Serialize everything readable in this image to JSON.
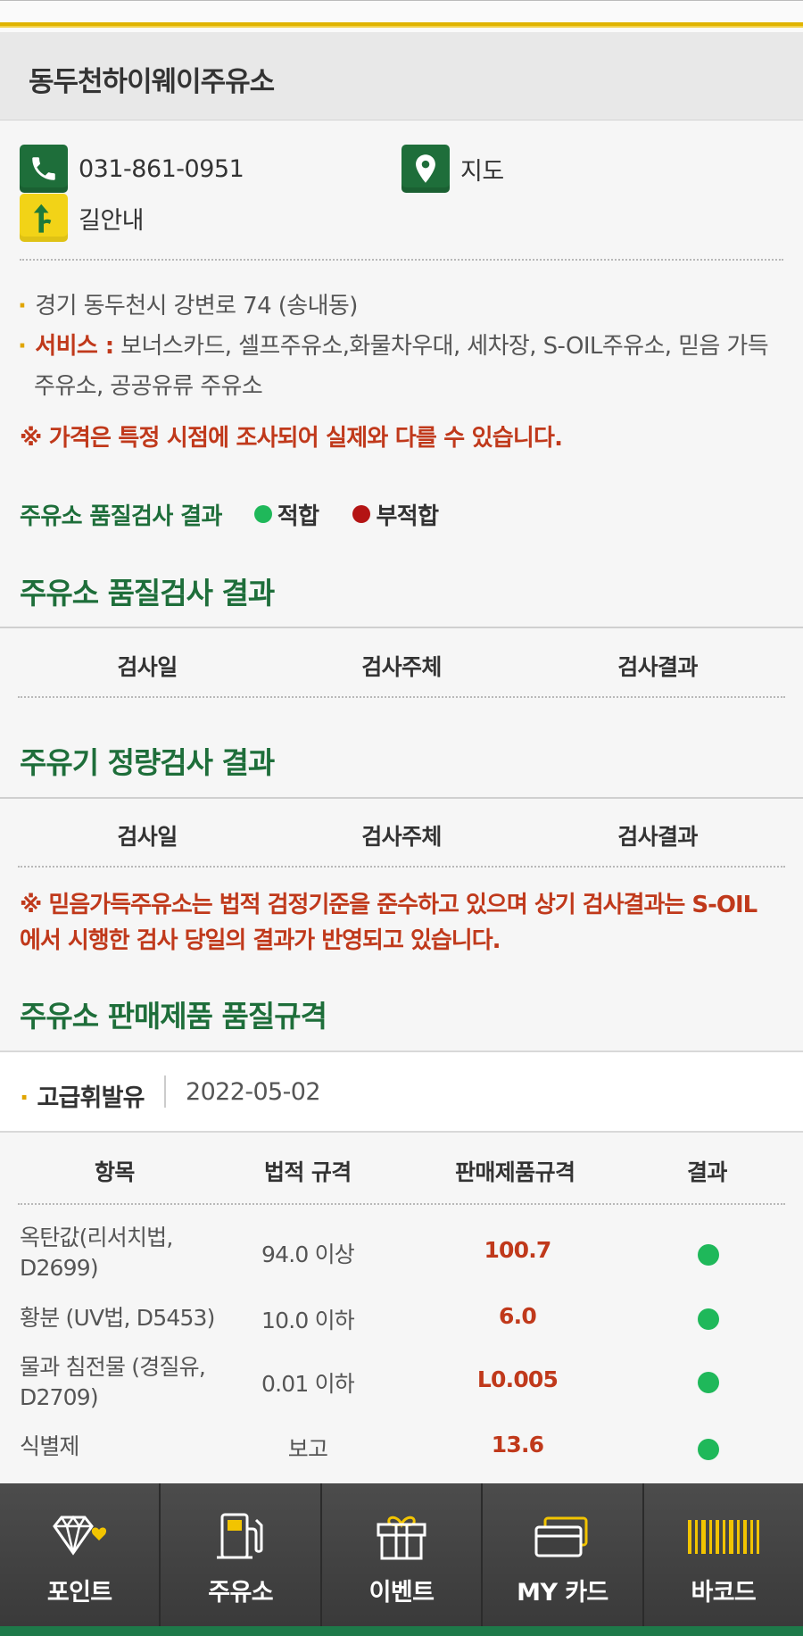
{
  "station": {
    "name": "동두천하이웨이주유소",
    "phone": "031-861-0951",
    "map_label": "지도",
    "directions_label": "길안내",
    "address": "경기 동두천시 강변로 74 (송내동)",
    "services_label": "서비스 :",
    "services_line1": "보너스카드, 셀프주유소,화물차우대, 세차장, S-OIL주유소, 믿음 가득",
    "services_line2": "주유소, 공공유류 주유소",
    "price_notice": "※ 가격은 특정 시점에 조사되어 실제와 다를 수 있습니다."
  },
  "legend": {
    "title": "주유소 품질검사 결과",
    "pass_label": "적합",
    "fail_label": "부적합",
    "pass_color": "#1fb85a",
    "fail_color": "#b41414"
  },
  "quality_section": {
    "title": "주유소 품질검사 결과",
    "col_date": "검사일",
    "col_agency": "검사주체",
    "col_result": "검사결과"
  },
  "meter_section": {
    "title": "주유기 정량검사 결과",
    "col_date": "검사일",
    "col_agency": "검사주체",
    "col_result": "검사결과"
  },
  "trust_notice_line1": "※ 믿음가득주유소는 법적 검정기준을 준수하고 있으며 상기 검사결과는 S-OIL",
  "trust_notice_line2": "에서 시행한 검사 당일의 결과가 반영되고 있습니다.",
  "spec_section": {
    "title": "주유소 판매제품 품질규격",
    "product_name": "고급휘발유",
    "product_date": "2022-05-02",
    "headers": {
      "item": "항목",
      "legal": "법적 규격",
      "product": "판매제품규격",
      "result": "결과"
    },
    "rows": [
      {
        "item": "옥탄값(리서치법, D2699)",
        "legal": "94.0 이상",
        "product": "100.7",
        "result": "적합"
      },
      {
        "item": "황분 (UV법, D5453)",
        "legal": "10.0 이하",
        "product": "6.0",
        "result": "적합"
      },
      {
        "item": "물과 침전물 (경질유, D2709)",
        "legal": "0.01 이하",
        "product": "L0.005",
        "result": "적합"
      },
      {
        "item": "식별제",
        "legal": "보고",
        "product": "13.6",
        "result": "적합"
      }
    ]
  },
  "bottom_nav": {
    "point": "포인트",
    "station": "주유소",
    "event": "이벤트",
    "mycard": "MY 카드",
    "barcode": "바코드"
  },
  "colors": {
    "brand_green": "#1e6e3a",
    "notice_red": "#c0391b",
    "accent_gold": "#e0b400"
  }
}
